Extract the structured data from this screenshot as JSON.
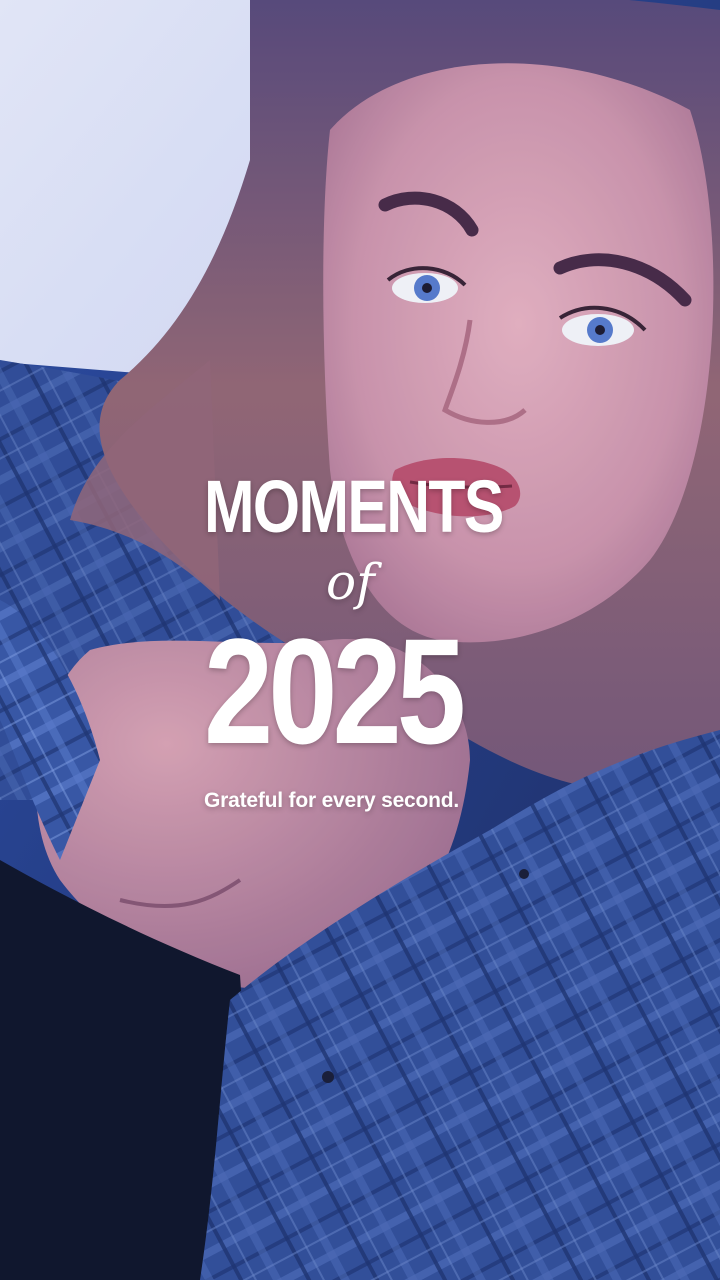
{
  "overlay": {
    "title_line_1": "MOMENTS",
    "title_line_2": "of",
    "title_line_3": "2025",
    "caption": "Grateful for every second."
  },
  "colors": {
    "overlay_text": "#ffffff",
    "window_light": "#e9eefc",
    "curtain_blue": "#2f63d8",
    "shirt_blue": "#3e5fae",
    "hair": "#8a5b6b",
    "skin": "#d8a6b7"
  }
}
